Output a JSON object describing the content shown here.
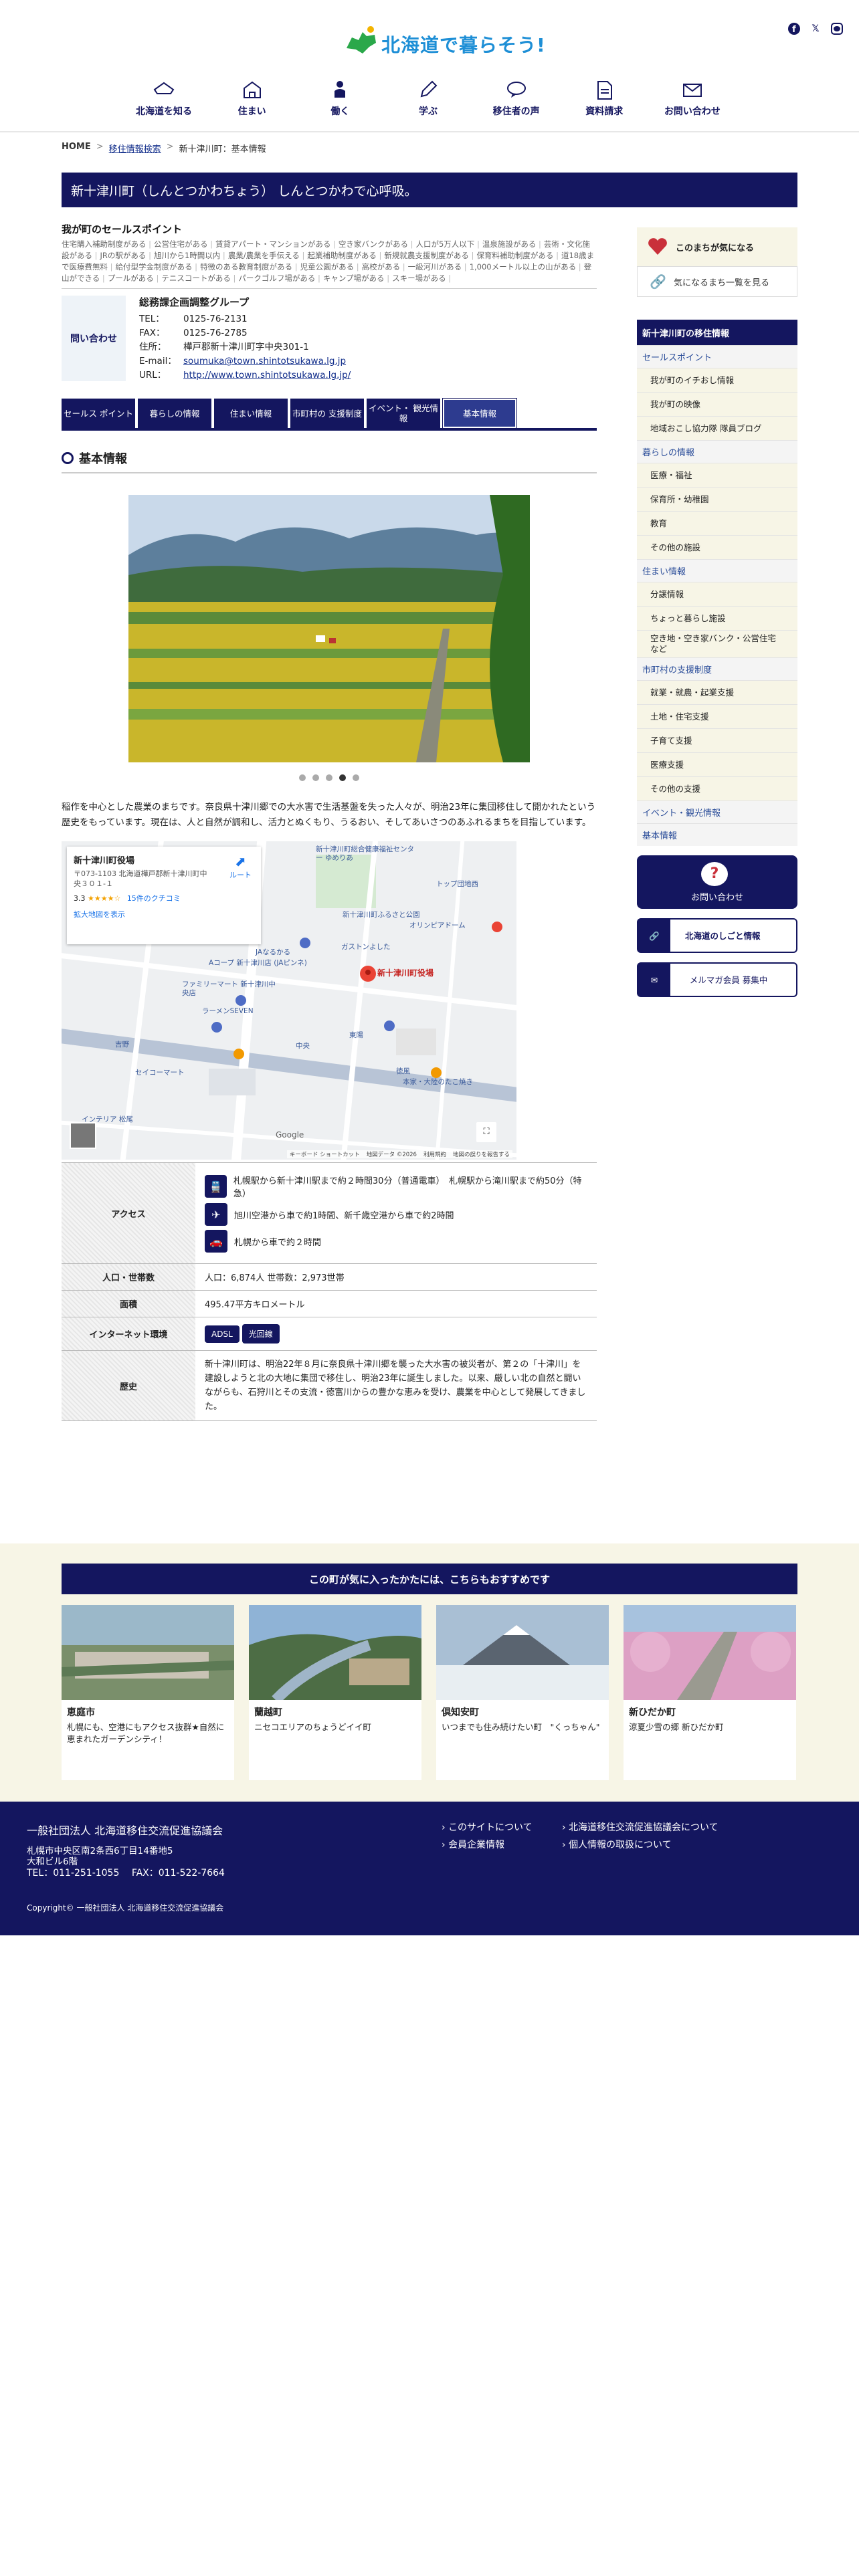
{
  "header": {
    "logo_text": "北海道で暮らそう!",
    "social": [
      "facebook-icon",
      "x-icon",
      "line-icon"
    ],
    "nav": [
      {
        "label": "北海道を知る",
        "icon": "house-icon"
      },
      {
        "label": "住まい",
        "icon": "home-icon"
      },
      {
        "label": "働く",
        "icon": "worker-icon"
      },
      {
        "label": "学ぶ",
        "icon": "pencil-icon"
      },
      {
        "label": "移住者の声",
        "icon": "speech-icon"
      },
      {
        "label": "資料請求",
        "icon": "document-icon"
      },
      {
        "label": "お問い合わせ",
        "icon": "mail-icon"
      }
    ]
  },
  "breadcrumb": {
    "home": "HOME",
    "sep": ">",
    "search": "移住情報検索",
    "current": "新十津川町：基本情報"
  },
  "page_title": "新十津川町（しんとつかわちょう） しんとつかわで心呼吸。",
  "selling": {
    "heading": "我が町のセールスポイント",
    "tags": [
      "住宅購入補助制度がある",
      "公営住宅がある",
      "賃貸アパート・マンションがある",
      "空き家バンクがある",
      "人口が5万人以下",
      "温泉施設がある",
      "芸術・文化施設がある",
      "JRの駅がある",
      "旭川から1時間以内",
      "農業/農業を手伝える",
      "起業補助制度がある",
      "新規就農支援制度がある",
      "保育料補助制度がある",
      "道18歳まで医療費無料",
      "給付型学金制度がある",
      "特徴のある教育制度がある",
      "児童公園がある",
      "高校がある",
      "一級河川がある",
      "1,000メートル以上の山がある",
      "登山ができる",
      "プールがある",
      "テニスコートがある",
      "パークゴルフ場がある",
      "キャンプ場がある",
      "スキー場がある"
    ]
  },
  "contact": {
    "box_label": "問い合わせ",
    "dept": "総務課企画調整グループ",
    "rows": [
      {
        "k": "TEL：",
        "v": "0125-76-2131"
      },
      {
        "k": "FAX：",
        "v": "0125-76-2785"
      },
      {
        "k": "住所：",
        "v": "樺戸郡新十津川町字中央301-1"
      },
      {
        "k": "E-mail：",
        "v": "soumuka@town.shintotsukawa.lg.jp"
      },
      {
        "k": "URL：",
        "v": "http://www.town.shintotsukawa.lg.jp/"
      }
    ]
  },
  "tabs": [
    "セールス ポイント",
    "暮らしの情報",
    "住まい情報",
    "市町村の 支援制度",
    "イベント・ 観光情報",
    "基本情報"
  ],
  "section_title": "基本情報",
  "photo": {
    "dots": 5,
    "active": 3
  },
  "intro": "稲作を中心とした農業のまちです。奈良県十津川郷での大水害で生活基盤を失った人々が、明治23年に集団移住して開かれたという歴史をもっています。現在は、人と自然が調和し、活力とぬくもり、うるおい、そしてあいさつのあふれるまちを目指しています。",
  "map": {
    "place": "新十津川町役場",
    "address": "〒073-1103 北海道樺戸郡新十津川町中央３０１-１",
    "rating": "3.3",
    "stars": "★★★★☆",
    "reviews": "15件のクチコミ",
    "enlarge": "拡大地図を表示",
    "route": "ルート",
    "pin_label": "新十津川町役場",
    "labels": [
      "新十津川町総合健康福祉センター ゆめりあ",
      "トップ団地西",
      "新十津川町ふるさと公園",
      "オリンピアドーム",
      "JAなるかる",
      "ガストンよした",
      "Aコープ 新十津川店 (JAピンネ)",
      "ファミリーマート 新十津川中央店",
      "ラーメンSEVEN",
      "東陽",
      "吉野",
      "中央",
      "徳風",
      "本家・大陸のたこ焼き",
      "セイコーマート",
      "インテリア 松尾"
    ],
    "footer": [
      "キーボード ショートカット",
      "地図データ ©2026",
      "利用規約",
      "地図の誤りを報告する"
    ],
    "google": "Google"
  },
  "info": {
    "access_label": "アクセス",
    "access": [
      {
        "icon": "train-icon",
        "text": "札幌駅から新十津川駅まで約２時間30分（普通電車）　札幌駅から滝川駅まで約50分（特急）"
      },
      {
        "icon": "plane-icon",
        "text": "旭川空港から車で約1時間、新千歳空港から車で約2時間"
      },
      {
        "icon": "car-icon",
        "text": "札幌から車で約２時間"
      }
    ],
    "pop_label": "人口・世帯数",
    "pop": "人口：6,874人 世帯数：2,973世帯",
    "area_label": "面積",
    "area": "495.47平方キロメートル",
    "net_label": "インターネット環境",
    "net": [
      "ADSL",
      "光回線"
    ],
    "history_label": "歴史",
    "history": "新十津川町は、明治22年８月に奈良県十津川郷を襲った大水害の被災者が、第２の「十津川」を建設しようと北の大地に集団で移住し、明治23年に誕生しました。以来、厳しい北の自然と闘いながらも、石狩川とその支流・徳富川からの豊かな恵みを受け、農業を中心として発展してきました。"
  },
  "sidebar": {
    "fav": "このまちが気になる",
    "fav_list": "気になるまち一覧を見る",
    "head": "新十津川町の移住情報",
    "cats": [
      {
        "label": "セールスポイント",
        "items": [
          "我が町のイチおし情報",
          "我が町の映像",
          "地域おこし協力隊 隊員ブログ"
        ]
      },
      {
        "label": "暮らしの情報",
        "items": [
          "医療・福祉",
          "保育所・幼稚園",
          "教育",
          "その他の施設"
        ]
      },
      {
        "label": "住まい情報",
        "items": [
          "分譲情報",
          "ちょっと暮らし施設",
          "空き地・空き家バンク・公営住宅など"
        ]
      },
      {
        "label": "市町村の支援制度",
        "items": [
          "就業・就農・起業支援",
          "土地・住宅支援",
          "子育て支援",
          "医療支援",
          "その他の支援"
        ]
      },
      {
        "label": "イベント・観光情報",
        "items": []
      },
      {
        "label": "基本情報",
        "items": []
      }
    ],
    "contact_btn": "お問い合わせ",
    "job_link": "北海道のしごと情報",
    "mail_link": "メルマガ会員 募集中"
  },
  "recommend": {
    "band": "この町が気に入ったかたには、こちらもおすすめです",
    "cards": [
      {
        "name": "恵庭市",
        "desc": "札幌にも、空港にもアクセス抜群★自然に恵まれたガーデンシティ！"
      },
      {
        "name": "蘭越町",
        "desc": "ニセコエリアのちょうどイイ町"
      },
      {
        "name": "倶知安町",
        "desc": "いつまでも住み続けたい町　\"くっちゃん\""
      },
      {
        "name": "新ひだか町",
        "desc": "涼夏少雪の郷 新ひだか町"
      }
    ]
  },
  "footer": {
    "org": "一般社団法人 北海道移住交流促進協議会",
    "addr1": "札幌市中央区南2条西6丁目14番地5",
    "addr2": "大和ビル6階",
    "tel": "TEL：011-251-1055　 FAX：011-522-7664",
    "links": [
      "このサイトについて",
      "北海道移住交流促進協議会について",
      "会員企業情報",
      "個人情報の取扱について"
    ],
    "copy": "Copyright© 一般社団法人 北海道移住交流促進協議会"
  },
  "colors": {
    "navy": "#14165f",
    "cream": "#f7f5e6",
    "link": "#14308c"
  }
}
